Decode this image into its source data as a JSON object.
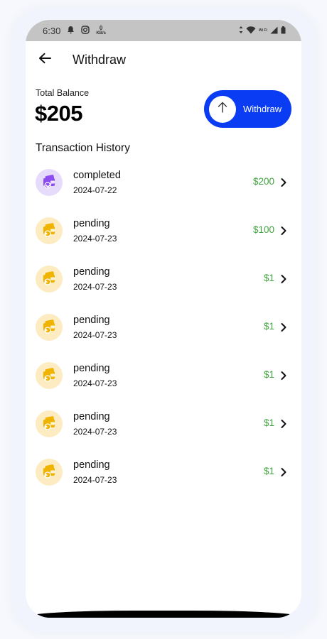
{
  "status_bar": {
    "time": "6:30",
    "speed_value": "0",
    "speed_unit": "KB/s",
    "wifi_label": "Wi Fi"
  },
  "header": {
    "title": "Withdraw"
  },
  "balance": {
    "label": "Total Balance",
    "amount": "$205"
  },
  "withdraw_button": {
    "label": "Withdraw"
  },
  "history": {
    "title": "Transaction History",
    "transactions": [
      {
        "status": "completed",
        "date": "2024-07-22",
        "amount": "$200"
      },
      {
        "status": "pending",
        "date": "2024-07-23",
        "amount": "$100"
      },
      {
        "status": "pending",
        "date": "2024-07-23",
        "amount": "$1"
      },
      {
        "status": "pending",
        "date": "2024-07-23",
        "amount": "$1"
      },
      {
        "status": "pending",
        "date": "2024-07-23",
        "amount": "$1"
      },
      {
        "status": "pending",
        "date": "2024-07-23",
        "amount": "$1"
      },
      {
        "status": "pending",
        "date": "2024-07-23",
        "amount": "$1"
      }
    ]
  },
  "colors": {
    "accent": "#0a3cf3",
    "amount_green": "#3fa33f",
    "completed_bg": "#e6dbfb",
    "completed_icon": "#8b4cf0",
    "pending_bg": "#fdebc2",
    "pending_icon": "#f0b400"
  },
  "icons": {
    "back": "arrow-left-icon",
    "withdraw": "arrow-up-icon",
    "transaction": "wallet-icon",
    "row_chevron": "chevron-right-icon"
  }
}
